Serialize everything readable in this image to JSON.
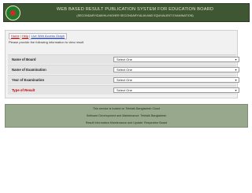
{
  "header": {
    "title": "WEB BASED RESULT PUBLICATION SYSTEM FOR EDUCATION BOARD",
    "subtitle": "(SECONDARY/DAKHIL/HIGHER SECONDARY/ALIM AND EQUIVALENT EXAMINATION)"
  },
  "form": {
    "links": {
      "home": "Home",
      "sep1": " | ",
      "help": "Help",
      "sep2": " | ",
      "graph": "Live Web Access Graph"
    },
    "instruction": "Please provide the following information to view result",
    "fields": [
      {
        "label": "Name of Board",
        "value": "Select One"
      },
      {
        "label": "Name of Examination",
        "value": "Select One"
      },
      {
        "label": "Year of Examination",
        "value": "Select One"
      },
      {
        "label": "Type of Result",
        "value": "Select One"
      }
    ]
  },
  "footer": {
    "line1": "This service is hosted on Teletalk Bangladesh Cloud",
    "line2": "Software Development and Maintenance: Teletalk Bangladesh",
    "line3": "Result Information Maintenance and Update: Respective Board"
  },
  "colors": {
    "header_bg": "#3f5633",
    "footer_bg": "#97a88c",
    "link_red": "#c00000",
    "link_blue": "#1f3fbf"
  }
}
